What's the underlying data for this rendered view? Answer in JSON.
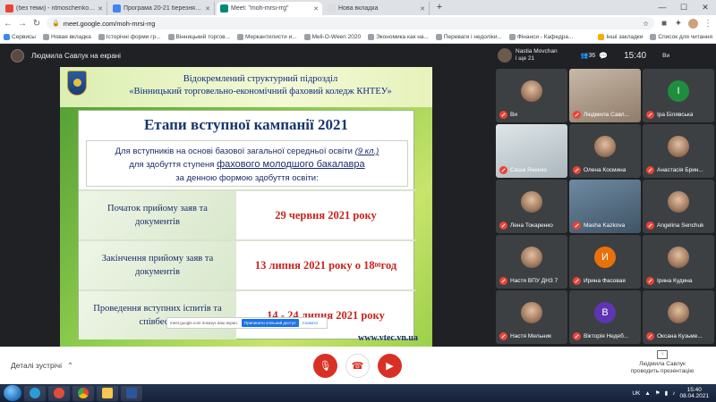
{
  "browser": {
    "tabs": [
      {
        "title": "(без теми) - ntmoschenkom@g",
        "color": "#ea4335",
        "active": false
      },
      {
        "title": "Програма 20-21 березня 2021",
        "color": "#4285f4",
        "active": false
      },
      {
        "title": "Meet: \"moh-mrsi-rrg\"",
        "color": "#00897b",
        "active": true
      },
      {
        "title": "Нова вкладка",
        "color": "#dadce0",
        "active": false
      }
    ],
    "url": "meet.google.com/moh-mrsi-rrg",
    "bookmarks": [
      "Сервисы",
      "Новая вкладка",
      "Історічні форми гр...",
      "Вінницький торгов...",
      "Меркантилисти и...",
      "Mell-O-Ween 2020",
      "Экономика как на...",
      "Переваги і недоліки...",
      "Фінанси - Кафедра..."
    ],
    "bookmarks_right": [
      "Інші закладки",
      "Список для читання"
    ]
  },
  "meet": {
    "presenter_label": "Людмила Савлук на екрані",
    "self_name": "Nastia Movchan",
    "self_sub": "і ще 21",
    "people_count": "36",
    "time": "15:40",
    "you_label": "Ви",
    "details_label": "Деталі зустрічі",
    "presenting_line1": "Людмила Савлук",
    "presenting_line2": "проводить презентацію",
    "share_bar_text": "meet.google.com показує ваш екран.",
    "share_bar_stop": "Припинити спільний доступ",
    "share_bar_hide": "Сховати"
  },
  "slide": {
    "header1": "Відокремлений структурний підрозділ",
    "header2": "«Вінницький торговельно-економічний фаховий коледж КНТЕУ»",
    "title": "Етапи вступної кампанії 2021",
    "sub_line1_a": "Для вступників на основі базової загальної середньої освіти",
    "sub_line1_b": "(9 кл.)",
    "sub_line2_a": "для здобуття ступеня",
    "sub_line2_b": "фахового молодшого бакалавра",
    "sub_line3": "за денною формою здобуття освіти:",
    "rows": [
      {
        "label": "Початок прийому заяв та документів",
        "value": "29 червня 2021 року",
        "sup": ""
      },
      {
        "label": "Закінчення прийому заяв та документів",
        "value": "13 липня 2021 року о 18",
        "sup": "00",
        "suffix": " год"
      },
      {
        "label": "Проведення вступних іспитів та співбесід",
        "value": "14 - 24 липня 2021 року",
        "sup": ""
      }
    ],
    "url": "www.vtec.vn.ua"
  },
  "participants": [
    {
      "name": "Ви",
      "initial": "",
      "kind": "photo"
    },
    {
      "name": "Людмила Савл...",
      "initial": "",
      "kind": "video"
    },
    {
      "name": "Іра Білявська",
      "initial": "I",
      "kind": "letter",
      "color": "#1e8e3e"
    },
    {
      "name": "Саша Яненко",
      "initial": "",
      "kind": "video2"
    },
    {
      "name": "Олена Космина",
      "initial": "",
      "kind": "photo"
    },
    {
      "name": "Анастасія Брин...",
      "initial": "",
      "kind": "photo"
    },
    {
      "name": "Лена Токаренко",
      "initial": "",
      "kind": "photo"
    },
    {
      "name": "Masha Kazkova",
      "initial": "",
      "kind": "video3"
    },
    {
      "name": "Angelina Senchuk",
      "initial": "",
      "kind": "photo"
    },
    {
      "name": "Настя ВПУ ДНЗ 7",
      "initial": "",
      "kind": "photo"
    },
    {
      "name": "Ирина Фасовая",
      "initial": "И",
      "kind": "letter",
      "color": "#e8710a"
    },
    {
      "name": "Ірина Кудина",
      "initial": "",
      "kind": "photo"
    },
    {
      "name": "Настя Мельник",
      "initial": "",
      "kind": "photo"
    },
    {
      "name": "Вікторія Недеб...",
      "initial": "В",
      "kind": "letter",
      "color": "#5e35b1"
    },
    {
      "name": "Оксана Кузьме...",
      "initial": "",
      "kind": "photo"
    }
  ],
  "taskbar": {
    "lang": "UK",
    "clock_time": "15:40",
    "clock_date": "08.04.2021"
  }
}
